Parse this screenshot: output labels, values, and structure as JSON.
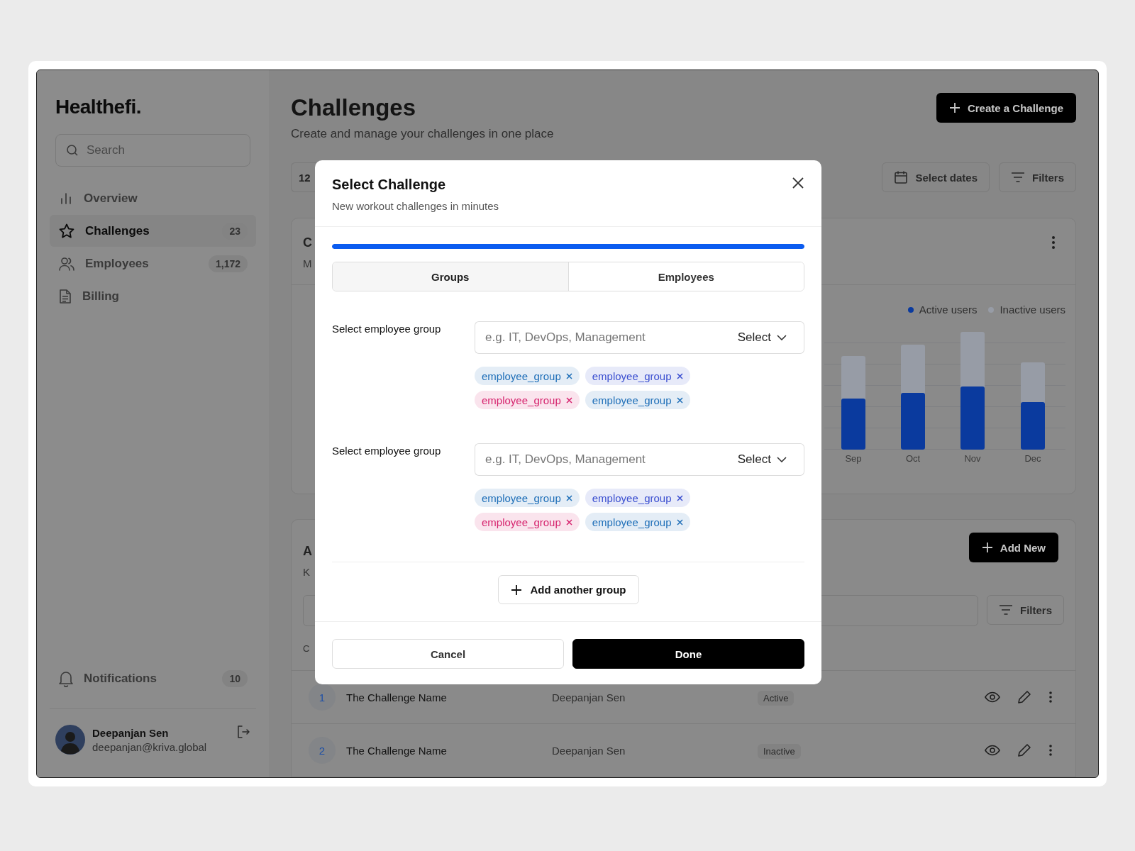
{
  "sidebar": {
    "logo": "Healthefi.",
    "search": {
      "placeholder": "Search"
    },
    "nav": [
      {
        "label": "Overview",
        "selected": false
      },
      {
        "label": "Challenges",
        "selected": true,
        "count": "23"
      },
      {
        "label": "Employees",
        "selected": false,
        "count": "1,172"
      },
      {
        "label": "Billing",
        "selected": false
      }
    ],
    "notifications": {
      "label": "Notifications",
      "count": "10"
    },
    "user": {
      "name": "Deepanjan Sen",
      "email": "deepanjan@kriva.global"
    }
  },
  "header": {
    "title": "Challenges",
    "subtitle": "Create and manage your challenges in one place",
    "button": "Create a Challenge"
  },
  "toolbar": {
    "period_tab": "12",
    "buttons": [
      "Select dates",
      "Filters"
    ]
  },
  "chart_card": {
    "title": "C",
    "subtitle": "M",
    "legend": [
      {
        "label": "Active users",
        "color": "#0a3a9e"
      },
      {
        "label": "Inactive users",
        "color": "#979ca6"
      }
    ],
    "categories": [
      "Sep",
      "Oct",
      "Nov",
      "Dec"
    ]
  },
  "table_card": {
    "title": "A",
    "subtitle": "K",
    "add_button": "Add New",
    "filters_button": "Filters",
    "column_1": "C",
    "rows": [
      {
        "index": "1",
        "name": "The Challenge Name",
        "owner": "Deepanjan Sen",
        "status": "Active"
      },
      {
        "index": "2",
        "name": "The Challenge Name",
        "owner": "Deepanjan Sen",
        "status": "Inactive"
      }
    ]
  },
  "modal": {
    "title": "Select Challenge",
    "subtitle": "New workout challenges in minutes",
    "progress": {
      "level": 1
    },
    "tabs": [
      {
        "label": "Groups",
        "selected": true
      },
      {
        "label": "Employees",
        "selected": false
      }
    ],
    "groups": [
      {
        "label": "Select employee group",
        "placeholder": "e.g. IT, DevOps, Management",
        "select": "Select",
        "chips": [
          {
            "text": "employee_group",
            "color": "#1f6fb8"
          },
          {
            "text": "employee_group",
            "color": "#3b4fd0"
          },
          {
            "text": "employee_group",
            "color": "#d6246e"
          },
          {
            "text": "employee_group",
            "color": "#1f6fb8"
          }
        ]
      },
      {
        "label": "Select employee group",
        "placeholder": "e.g. IT, DevOps, Management",
        "select": "Select",
        "chips": [
          {
            "text": "employee_group",
            "color": "#1f6fb8"
          },
          {
            "text": "employee_group",
            "color": "#3b4fd0"
          },
          {
            "text": "employee_group",
            "color": "#d6246e"
          },
          {
            "text": "employee_group",
            "color": "#1f6fb8"
          }
        ]
      }
    ],
    "add_button": "Add another group",
    "cancel": "Cancel",
    "done": "Done"
  }
}
